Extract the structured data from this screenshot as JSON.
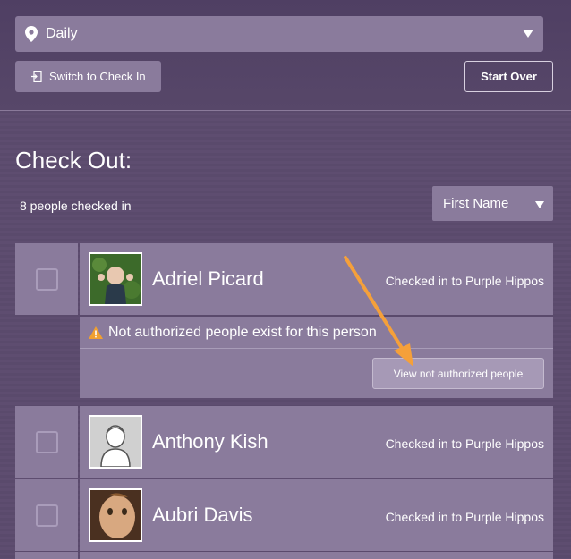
{
  "location": {
    "selected": "Daily"
  },
  "toolbar": {
    "switch_label": "Switch to Check In",
    "start_over_label": "Start Over"
  },
  "heading": "Check Out:",
  "count_text": "8 people checked in",
  "sort": {
    "selected": "First Name"
  },
  "people": [
    {
      "name": "Adriel Picard",
      "status": "Checked in to Purple Hippos"
    },
    {
      "name": "Anthony Kish",
      "status": "Checked in to Purple Hippos"
    },
    {
      "name": "Aubri Davis",
      "status": "Checked in to Purple Hippos"
    }
  ],
  "warning": {
    "text": "Not authorized people exist for this person",
    "button_label": "View not authorized people"
  },
  "colors": {
    "background": "#5e4d70",
    "panel": "#8a7b9c",
    "warning": "#f0a030",
    "arrow": "#f5a03a"
  }
}
